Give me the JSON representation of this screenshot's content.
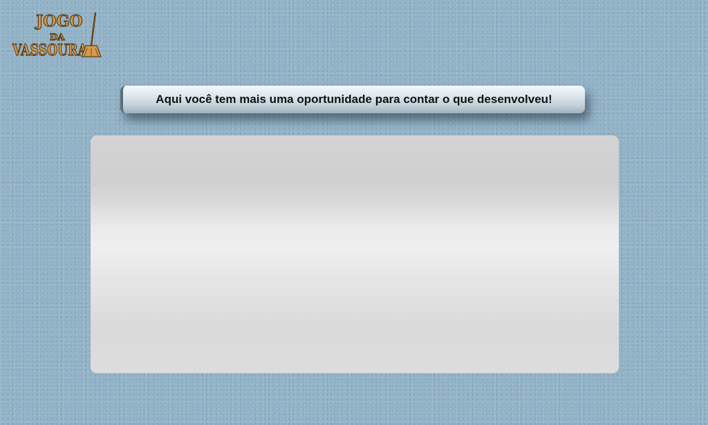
{
  "logo": {
    "line1": "JOGO",
    "line2": "DA",
    "line3": "VASSOURA",
    "icon": "broom-icon"
  },
  "banner": {
    "text": "Aqui você tem mais uma oportunidade para contar o que desenvolveu!"
  },
  "answer": {
    "value": ""
  },
  "colors": {
    "background": "#93b3c8",
    "logo": "#c9923f",
    "panel": "#e6e6e6"
  }
}
